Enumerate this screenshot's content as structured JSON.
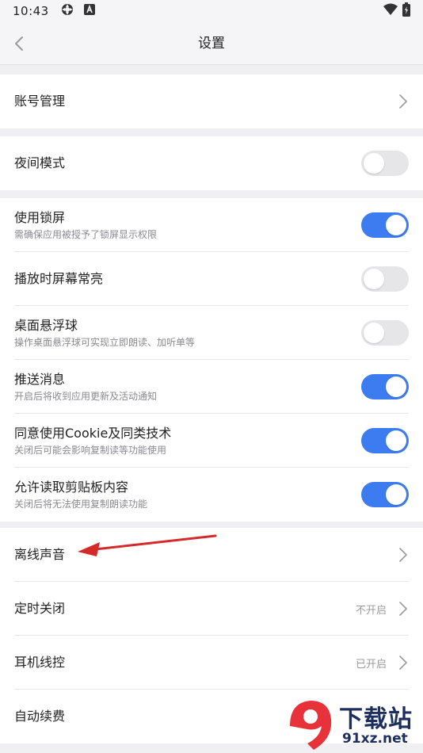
{
  "status_bar": {
    "time": "10:43",
    "icons": [
      "settings-app-icon",
      "app-a-icon"
    ],
    "right_icons": [
      "wifi-icon",
      "battery-charging-icon"
    ]
  },
  "header": {
    "title": "设置",
    "back_icon": "chevron-left-icon"
  },
  "account_group": {
    "items": [
      {
        "label": "账号管理",
        "control": "chevron"
      }
    ]
  },
  "night_group": {
    "items": [
      {
        "label": "夜间模式",
        "control": "toggle",
        "on": false
      }
    ]
  },
  "settings_group": {
    "items": [
      {
        "label": "使用锁屏",
        "sub": "需确保应用被授予了锁屏显示权限",
        "control": "toggle",
        "on": true
      },
      {
        "label": "播放时屏幕常亮",
        "control": "toggle",
        "on": false
      },
      {
        "label": "桌面悬浮球",
        "sub": "操作桌面悬浮球可实现立即朗读、加听单等",
        "control": "toggle",
        "on": false
      },
      {
        "label": "推送消息",
        "sub": "开启后将收到应用更新及活动通知",
        "control": "toggle",
        "on": true
      },
      {
        "label": "同意使用Cookie及同类技术",
        "sub": "关闭后可能会影响复制读等功能使用",
        "control": "toggle",
        "on": true
      },
      {
        "label": "允许读取剪贴板内容",
        "sub": "关闭后将无法使用复制朗读功能",
        "control": "toggle",
        "on": true
      }
    ]
  },
  "audio_group": {
    "items": [
      {
        "label": "离线声音",
        "control": "chevron"
      },
      {
        "label": "定时关闭",
        "value": "不开启",
        "control": "chevron"
      },
      {
        "label": "耳机线控",
        "value": "已开启",
        "control": "chevron"
      },
      {
        "label": "自动续费",
        "control": "none"
      }
    ]
  },
  "colors": {
    "accent": "#3d7cf0",
    "toggle_off": "#e6e6e9",
    "annotation_arrow": "#d42a2a",
    "background": "#f0f0f2"
  },
  "watermark": {
    "logo_mark": "9",
    "text_cn": "下载站",
    "text_en": "91xz.net"
  }
}
